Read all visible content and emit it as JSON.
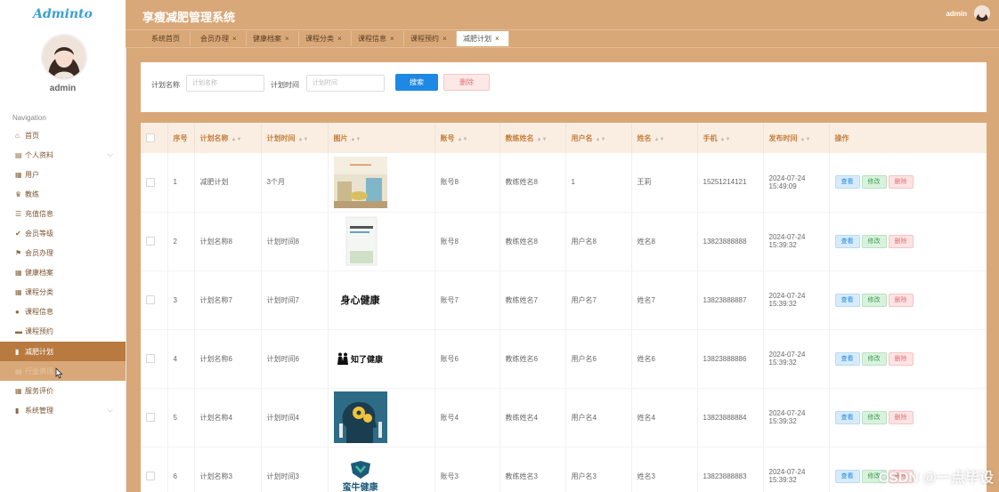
{
  "brand": "Adminto",
  "user": {
    "name": "admin"
  },
  "sidebar": {
    "heading": "Navigation",
    "items": [
      {
        "label": "首页",
        "icon": "home-icon",
        "glyph": "⌂"
      },
      {
        "label": "个人资料",
        "icon": "profile-icon",
        "glyph": "▤",
        "chevron": "⌵"
      },
      {
        "label": "用户",
        "icon": "grid-icon",
        "glyph": "▦"
      },
      {
        "label": "教练",
        "icon": "trophy-icon",
        "glyph": "♛"
      },
      {
        "label": "充值信息",
        "icon": "list-icon",
        "glyph": "☰"
      },
      {
        "label": "会员等级",
        "icon": "thumbs-up-icon",
        "glyph": "✔"
      },
      {
        "label": "会员办理",
        "icon": "flag-icon",
        "glyph": "⚑"
      },
      {
        "label": "健康档案",
        "icon": "grid-icon",
        "glyph": "▦"
      },
      {
        "label": "课程分类",
        "icon": "grid-icon",
        "glyph": "▦"
      },
      {
        "label": "课程信息",
        "icon": "user-icon",
        "glyph": "●"
      },
      {
        "label": "课程预约",
        "icon": "comment-icon",
        "glyph": "▬"
      },
      {
        "label": "减肥计划",
        "icon": "chart-icon",
        "glyph": "▮"
      },
      {
        "label": "行业资讯",
        "icon": "news-icon",
        "glyph": "▤"
      },
      {
        "label": "服务评价",
        "icon": "grid-icon",
        "glyph": "▦"
      },
      {
        "label": "系统管理",
        "icon": "bar-chart-icon",
        "glyph": "▮",
        "chevron": "⌵"
      }
    ]
  },
  "header": {
    "title": "享瘦减肥管理系统",
    "admin": "admin"
  },
  "tabs": [
    {
      "label": "系统首页",
      "close": ""
    },
    {
      "label": "会员办理",
      "close": "×"
    },
    {
      "label": "健康档案",
      "close": "×"
    },
    {
      "label": "课程分类",
      "close": "×"
    },
    {
      "label": "课程信息",
      "close": "×"
    },
    {
      "label": "课程预约",
      "close": "×"
    },
    {
      "label": "减肥计划",
      "close": "×"
    }
  ],
  "search": {
    "name_label": "计划名称",
    "name_placeholder": "计划名称",
    "name_value": "",
    "time_label": "计划时间",
    "time_placeholder": "计划时间",
    "time_value": "",
    "search_button": "搜索",
    "delete_button": "删除"
  },
  "table": {
    "columns": [
      "序号",
      "计划名称",
      "计划时间",
      "图片",
      "账号",
      "教练姓名",
      "用户名",
      "姓名",
      "手机",
      "发布时间",
      "操作"
    ],
    "actions": {
      "view": "查看",
      "edit": "修改",
      "delete": "删除"
    },
    "rows": [
      {
        "no": "1",
        "name": "减肥计划",
        "time": "3个月",
        "image": "room-photo",
        "account": "账号8",
        "coach": "教练姓名8",
        "username": "1",
        "realname": "王莉",
        "phone": "15251214121",
        "published": "2024-07-24 15:49:09"
      },
      {
        "no": "2",
        "name": "计划名称8",
        "time": "计划时间8",
        "image": "book-cover",
        "account": "账号8",
        "coach": "教练姓名8",
        "username": "用户名8",
        "realname": "姓名8",
        "phone": "13823888888",
        "published": "2024-07-24 15:39:32"
      },
      {
        "no": "3",
        "name": "计划名称7",
        "time": "计划时间7",
        "image": "logo-text",
        "image_text": "身心健康",
        "account": "账号7",
        "coach": "教练姓名7",
        "username": "用户名7",
        "realname": "姓名7",
        "phone": "13823888887",
        "published": "2024-07-24 15:39:32"
      },
      {
        "no": "4",
        "name": "计划名称6",
        "time": "计划时间6",
        "image": "logo-people",
        "image_text": "知了健康",
        "account": "账号6",
        "coach": "教练姓名6",
        "username": "用户名6",
        "realname": "姓名6",
        "phone": "13823888886",
        "published": "2024-07-24 15:39:32"
      },
      {
        "no": "5",
        "name": "计划名称4",
        "time": "计划时间4",
        "image": "gears-head",
        "account": "账号4",
        "coach": "教练姓名4",
        "username": "用户名4",
        "realname": "姓名4",
        "phone": "13823888884",
        "published": "2024-07-24 15:39:32"
      },
      {
        "no": "6",
        "name": "计划名称3",
        "time": "计划时间3",
        "image": "shield-logo",
        "image_text": "蛮牛健康",
        "account": "账号3",
        "coach": "教练姓名3",
        "username": "用户名3",
        "realname": "姓名3",
        "phone": "13823888883",
        "published": "2024-07-24 15:39:32"
      }
    ]
  },
  "watermark": "CSDN @一点毕设"
}
